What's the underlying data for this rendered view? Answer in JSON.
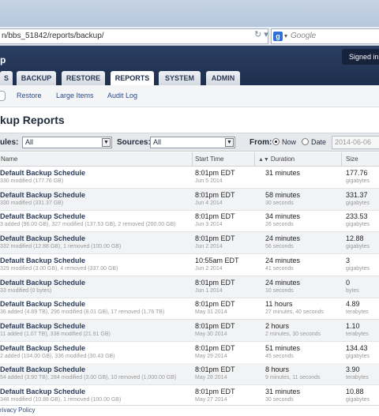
{
  "browser": {
    "url": "n/bbs_51842/reports/backup/",
    "search_placeholder": "Google"
  },
  "header": {
    "app_title": "p",
    "signed_in": "Signed in as"
  },
  "tabs": [
    {
      "label": "S"
    },
    {
      "label": "BACKUP"
    },
    {
      "label": "RESTORE"
    },
    {
      "label": "REPORTS"
    },
    {
      "label": "SYSTEM"
    },
    {
      "label": "ADMIN"
    }
  ],
  "subnav": {
    "items": [
      {
        "label": "Restore"
      },
      {
        "label": "Large Items"
      },
      {
        "label": "Audit Log"
      }
    ]
  },
  "page": {
    "title": "kup Reports"
  },
  "filters": {
    "schedules_label": "ules:",
    "schedules_value": "All",
    "sources_label": "Sources:",
    "sources_value": "All",
    "from_label": "From:",
    "now_label": "Now",
    "date_label": "Date",
    "date_value": "2014-06-06"
  },
  "table": {
    "headers": {
      "name": "Name",
      "start": "Start Time",
      "duration": "Duration",
      "size": "Size"
    },
    "rows": [
      {
        "name": "Default Backup Schedule",
        "detail": "330 modified (177.76 GB)",
        "start": "8:01pm EDT",
        "date": "Jun 5 2014",
        "duration": "31 minutes",
        "duration_sub": "",
        "size": "177.76",
        "unit": "gigabytes"
      },
      {
        "name": "Default Backup Schedule",
        "detail": "330 modified (331.37 GB)",
        "start": "8:01pm EDT",
        "date": "Jun 4 2014",
        "duration": "58 minutes",
        "duration_sub": "30 seconds",
        "size": "331.37",
        "unit": "gigabytes"
      },
      {
        "name": "Default Backup Schedule",
        "detail": "3 added (96.00 GB), 327 modified (137.53 GB), 2 removed (200.00 GB)",
        "start": "8:01pm EDT",
        "date": "Jun 3 2014",
        "duration": "34 minutes",
        "duration_sub": "26 seconds",
        "size": "233.53",
        "unit": "gigabytes"
      },
      {
        "name": "Default Backup Schedule",
        "detail": "332 modified (12.88 GB), 1 removed (100.00 GB)",
        "start": "8:01pm EDT",
        "date": "Jun 2 2014",
        "duration": "24 minutes",
        "duration_sub": "56 seconds",
        "size": "12.88",
        "unit": "gigabytes"
      },
      {
        "name": "Default Backup Schedule",
        "detail": "329 modified (3.00 GB), 4 removed (337.00 GB)",
        "start": "10:55am EDT",
        "date": "Jun 2 2014",
        "duration": "24 minutes",
        "duration_sub": "41 seconds",
        "size": "3",
        "unit": "gigabytes"
      },
      {
        "name": "Default Backup Schedule",
        "detail": "33 modified (0 bytes)",
        "start": "8:01pm EDT",
        "date": "Jun 1 2014",
        "duration": "24 minutes",
        "duration_sub": "10 seconds",
        "size": "0",
        "unit": "bytes"
      },
      {
        "name": "Default Backup Schedule",
        "detail": "36 added (4.89 TB), 296 modified (8.01 GB), 17 removed (1.76 TB)",
        "start": "8:01pm EDT",
        "date": "May 31 2014",
        "duration": "11 hours",
        "duration_sub": "27 minutes, 40 seconds",
        "size": "4.89",
        "unit": "terabytes"
      },
      {
        "name": "Default Backup Schedule",
        "detail": "11 added (1.07 TB), 338 modified (21.91 GB)",
        "start": "8:01pm EDT",
        "date": "May 30 2014",
        "duration": "2 hours",
        "duration_sub": "2 minutes, 30 seconds",
        "size": "1.10",
        "unit": "terabytes"
      },
      {
        "name": "Default Backup Schedule",
        "detail": "2 added (104.00 GB), 336 modified (30.43 GB)",
        "start": "8:01pm EDT",
        "date": "May 29 2014",
        "duration": "51 minutes",
        "duration_sub": "45 seconds",
        "size": "134.43",
        "unit": "gigabytes"
      },
      {
        "name": "Default Backup Schedule",
        "detail": "54 added (3.90 TB), 284 modified (3.00 GB), 10 removed (1,000.00 GB)",
        "start": "8:01pm EDT",
        "date": "May 28 2014",
        "duration": "8 hours",
        "duration_sub": "9 minutes, 11 seconds",
        "size": "3.90",
        "unit": "terabytes"
      },
      {
        "name": "Default Backup Schedule",
        "detail": "348 modified (10.88 GB), 1 removed (100.00 GB)",
        "start": "8:01pm EDT",
        "date": "May 27 2014",
        "duration": "31 minutes",
        "duration_sub": "30 seconds",
        "size": "10.88",
        "unit": "gigabytes"
      }
    ]
  },
  "footer": {
    "privacy": "rivacy Policy"
  }
}
